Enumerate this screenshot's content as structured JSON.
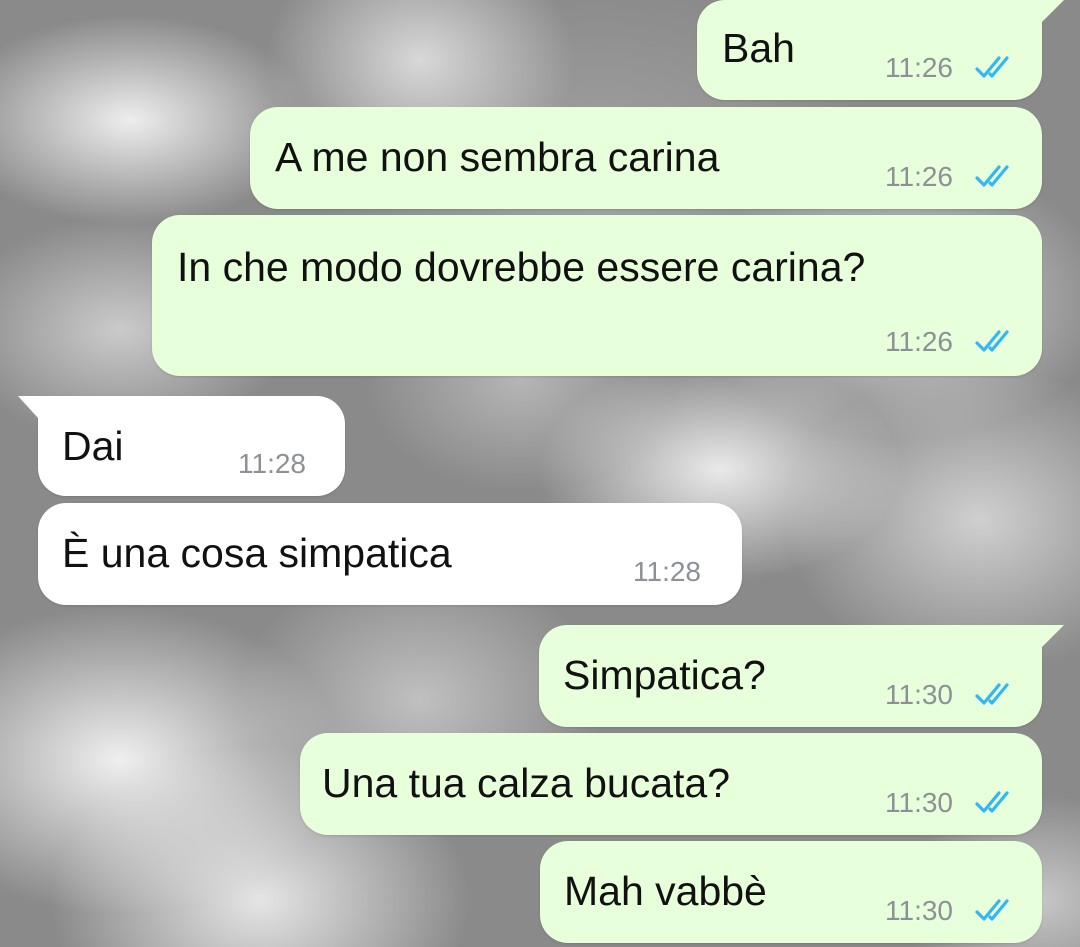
{
  "colors": {
    "outgoing_bubble": "#e7ffdb",
    "incoming_bubble": "#ffffff",
    "timestamp": "#8d9196",
    "read_ticks": "#34b7f1"
  },
  "messages": [
    {
      "direction": "outgoing",
      "text": "Bah",
      "time": "11:26",
      "status_icon": "double-check-read-icon"
    },
    {
      "direction": "outgoing",
      "text": "A me non sembra carina",
      "time": "11:26",
      "status_icon": "double-check-read-icon"
    },
    {
      "direction": "outgoing",
      "text": "In che modo dovrebbe essere carina?",
      "time": "11:26",
      "status_icon": "double-check-read-icon"
    },
    {
      "direction": "incoming",
      "text": "Dai",
      "time": "11:28"
    },
    {
      "direction": "incoming",
      "text": "È una cosa simpatica",
      "time": "11:28"
    },
    {
      "direction": "outgoing",
      "text": "Simpatica?",
      "time": "11:30",
      "status_icon": "double-check-read-icon"
    },
    {
      "direction": "outgoing",
      "text": "Una tua calza bucata?",
      "time": "11:30",
      "status_icon": "double-check-read-icon"
    },
    {
      "direction": "outgoing",
      "text": "Mah vabbè",
      "time": "11:30",
      "status_icon": "double-check-read-icon"
    }
  ]
}
